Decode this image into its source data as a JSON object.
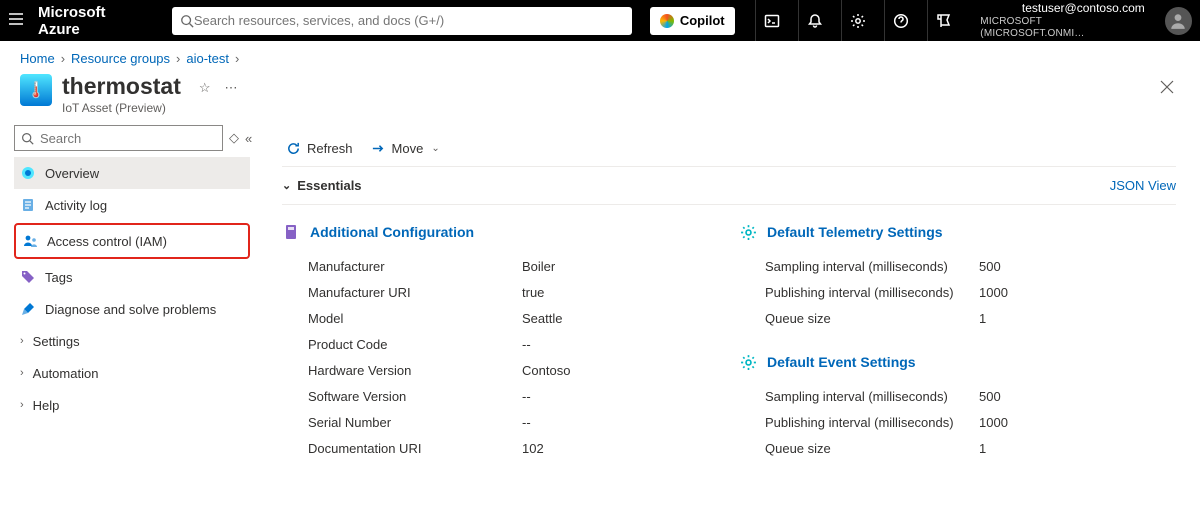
{
  "topbar": {
    "brand": "Microsoft Azure",
    "search_placeholder": "Search resources, services, and docs (G+/)",
    "copilot": "Copilot",
    "user": "testuser@contoso.com",
    "tenant": "MICROSOFT (MICROSOFT.ONMI…"
  },
  "breadcrumb": {
    "items": [
      "Home",
      "Resource groups",
      "aio-test"
    ]
  },
  "page": {
    "title": "thermostat",
    "subtitle": "IoT Asset (Preview)"
  },
  "toc": {
    "search_placeholder": "Search",
    "items": [
      {
        "label": "Overview"
      },
      {
        "label": "Activity log"
      },
      {
        "label": "Access control (IAM)"
      },
      {
        "label": "Tags"
      },
      {
        "label": "Diagnose and solve problems"
      },
      {
        "label": "Settings"
      },
      {
        "label": "Automation"
      },
      {
        "label": "Help"
      }
    ]
  },
  "cmdbar": {
    "refresh": "Refresh",
    "move": "Move"
  },
  "essentials": {
    "label": "Essentials",
    "json_view": "JSON View"
  },
  "left_section": {
    "title": "Additional Configuration",
    "rows": [
      {
        "k": "Manufacturer",
        "v": "Boiler"
      },
      {
        "k": "Manufacturer URI",
        "v": "true"
      },
      {
        "k": "Model",
        "v": "Seattle"
      },
      {
        "k": "Product Code",
        "v": "--"
      },
      {
        "k": "Hardware Version",
        "v": "Contoso"
      },
      {
        "k": "Software Version",
        "v": "--"
      },
      {
        "k": "Serial Number",
        "v": "--"
      },
      {
        "k": "Documentation URI",
        "v": "102"
      }
    ]
  },
  "right_sections": [
    {
      "title": "Default Telemetry Settings",
      "rows": [
        {
          "k": "Sampling interval (milliseconds)",
          "v": "500"
        },
        {
          "k": "Publishing interval (milliseconds)",
          "v": "1000"
        },
        {
          "k": "Queue size",
          "v": "1"
        }
      ]
    },
    {
      "title": "Default Event Settings",
      "rows": [
        {
          "k": "Sampling interval (milliseconds)",
          "v": "500"
        },
        {
          "k": "Publishing interval (milliseconds)",
          "v": "1000"
        },
        {
          "k": "Queue size",
          "v": "1"
        }
      ]
    }
  ]
}
